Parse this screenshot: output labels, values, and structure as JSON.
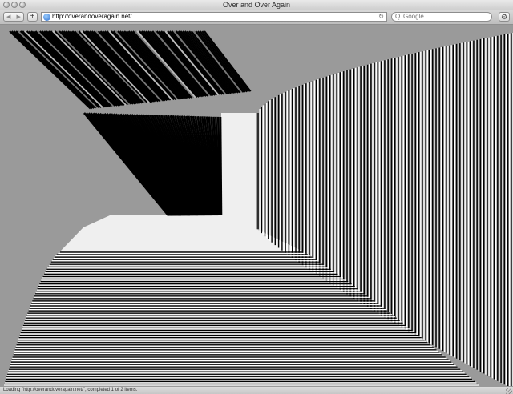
{
  "window": {
    "title": "Over and Over Again"
  },
  "toolbar": {
    "back_glyph": "◀",
    "forward_glyph": "▶",
    "add_glyph": "+",
    "url": "http://overandoveragain.net/",
    "reload_glyph": "↻",
    "search_glyph": "Q",
    "search_placeholder": "Google",
    "settings_glyph": "⚙"
  },
  "icons": [
    "close-icon",
    "minimize-icon",
    "zoom-icon",
    "back-icon",
    "forward-icon",
    "add-bookmark-icon",
    "globe-icon",
    "reload-icon",
    "search-icon",
    "gear-icon",
    "resize-grip-icon"
  ],
  "colors": {
    "page_background": "#9a9a9a",
    "stripe_dark": "#000000",
    "stripe_light": "#ffffff",
    "floor_light": "#efefef"
  },
  "status": {
    "text": "Loading \"http://overandoveragain.net/\", completed 1 of 2 items."
  }
}
